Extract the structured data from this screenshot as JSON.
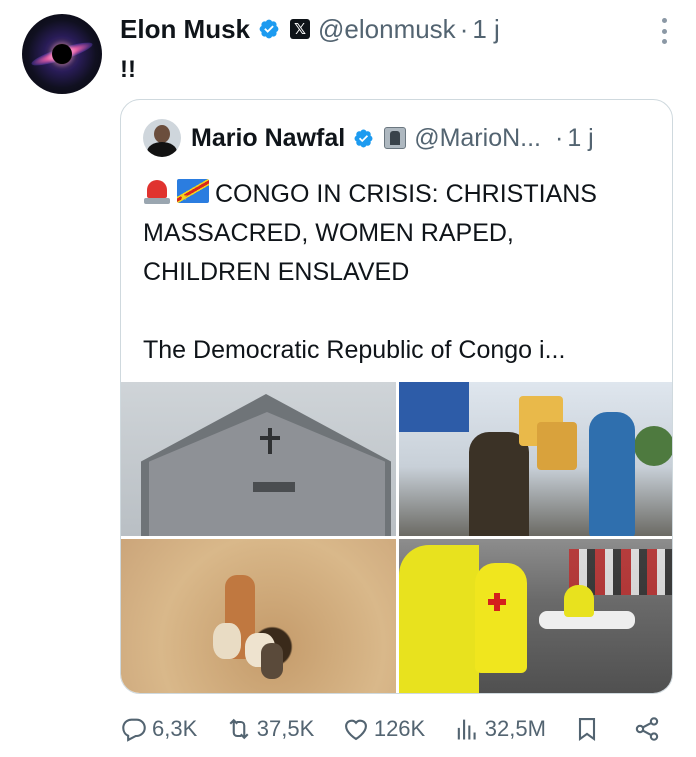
{
  "tweet": {
    "author_name": "Elon Musk",
    "handle": "@elonmusk",
    "separator": "·",
    "time": "1 j",
    "text": "!!"
  },
  "quoted": {
    "author_name": "Mario Nawfal",
    "handle": "@MarioN...",
    "separator": "·",
    "time": "1 j",
    "headline_lines": [
      "CONGO IN CRISIS: CHRISTIANS",
      "MASSACRED, WOMEN RAPED,",
      "CHILDREN ENSLAVED"
    ],
    "emojis": [
      "siren-emoji",
      "congo-flag-emoji"
    ],
    "body": "The Democratic Republic of Congo i..."
  },
  "actions": {
    "replies": "6,3K",
    "reposts": "37,5K",
    "likes": "126K",
    "views": "32,5M"
  },
  "colors": {
    "text": "#0f1419",
    "secondary": "#536471",
    "verified": "#1d9bf0",
    "border": "#cfd9de"
  }
}
